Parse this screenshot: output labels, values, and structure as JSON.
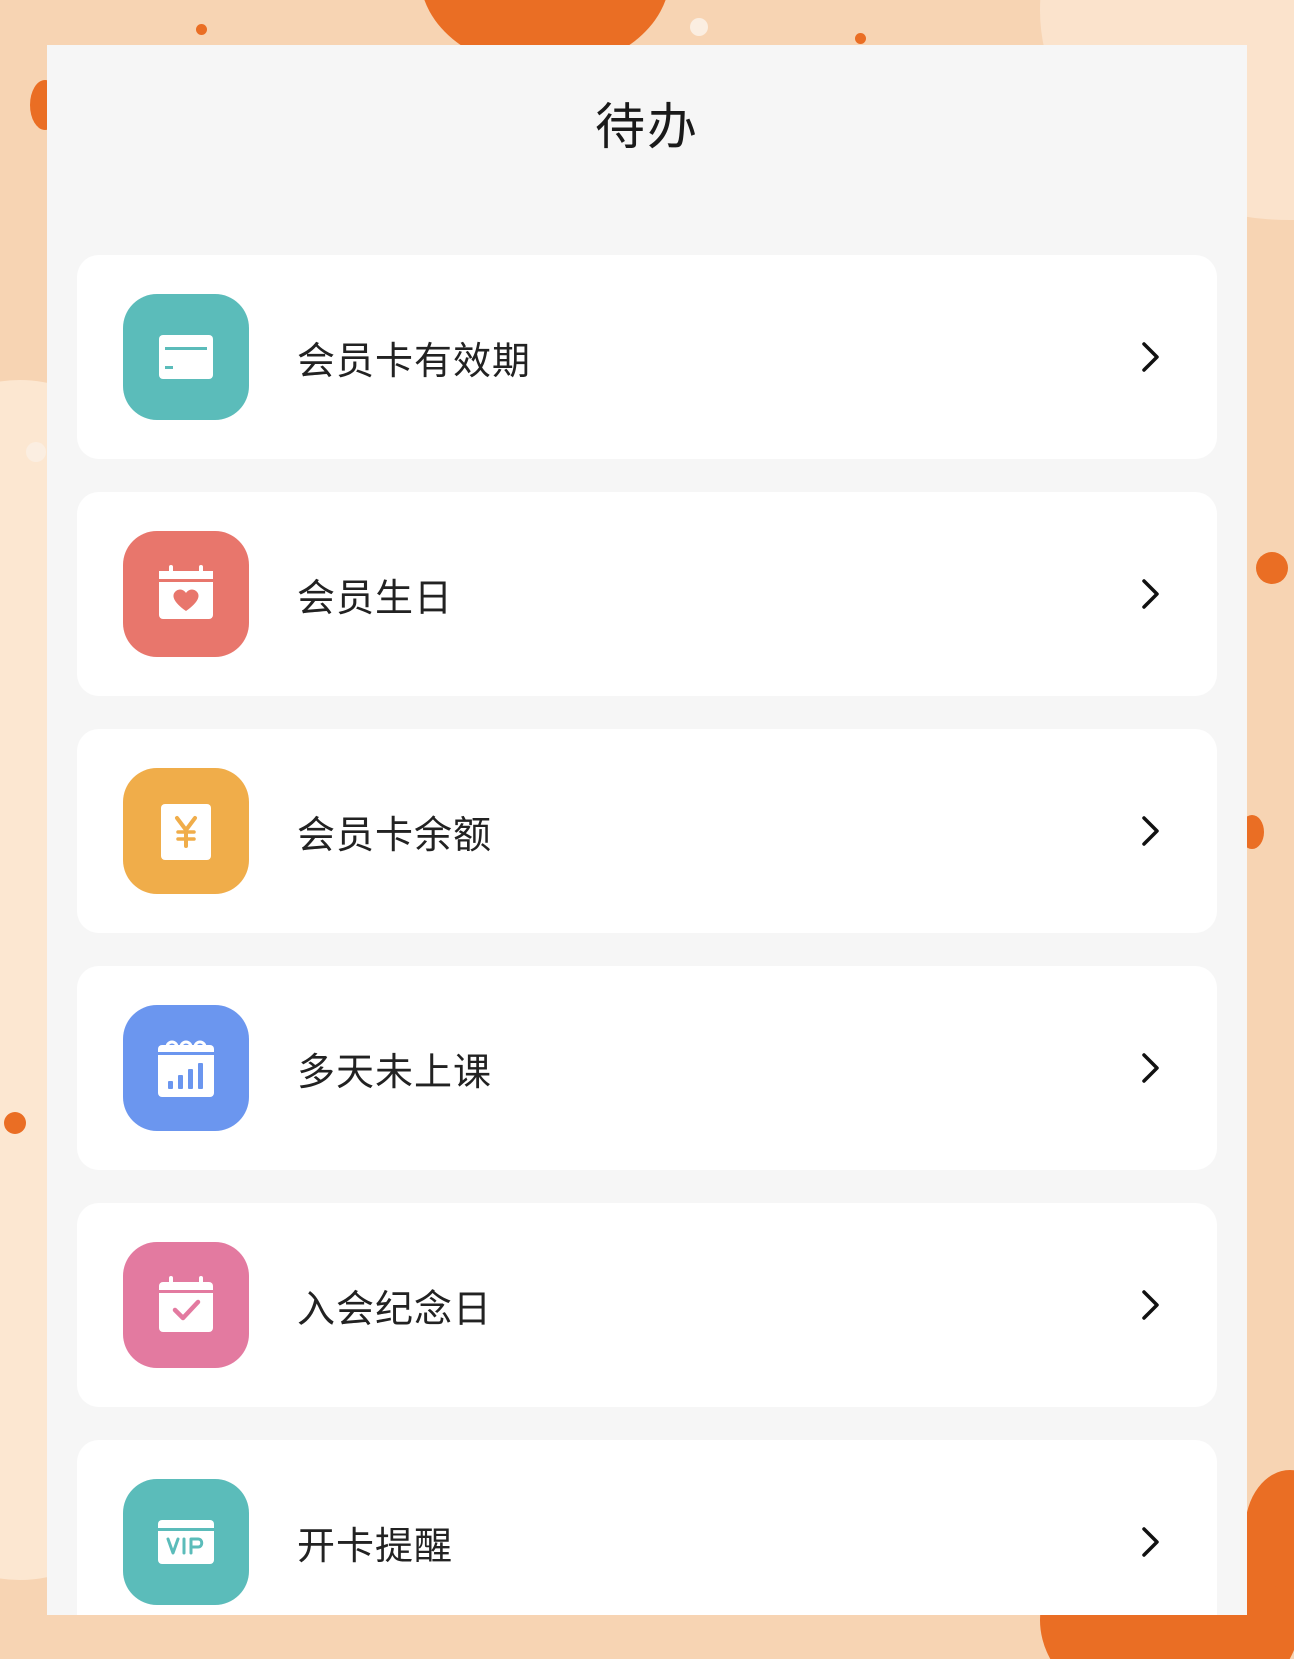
{
  "header": {
    "title": "待办"
  },
  "items": [
    {
      "label": "会员卡有效期",
      "icon": "membership-card-icon",
      "color": "#5bbcba"
    },
    {
      "label": "会员生日",
      "icon": "birthday-calendar-icon",
      "color": "#e8766c"
    },
    {
      "label": "会员卡余额",
      "icon": "balance-yen-icon",
      "color": "#f0ad4a"
    },
    {
      "label": "多天未上课",
      "icon": "attendance-chart-icon",
      "color": "#6b96ef"
    },
    {
      "label": "入会纪念日",
      "icon": "anniversary-calendar-icon",
      "color": "#e37aa0"
    },
    {
      "label": "开卡提醒",
      "icon": "vip-card-icon",
      "color": "#5bbcba"
    }
  ],
  "colors": {
    "background": "#f7d4b3",
    "accent": "#ea6e24",
    "panel": "#f6f6f6",
    "card": "#ffffff"
  }
}
